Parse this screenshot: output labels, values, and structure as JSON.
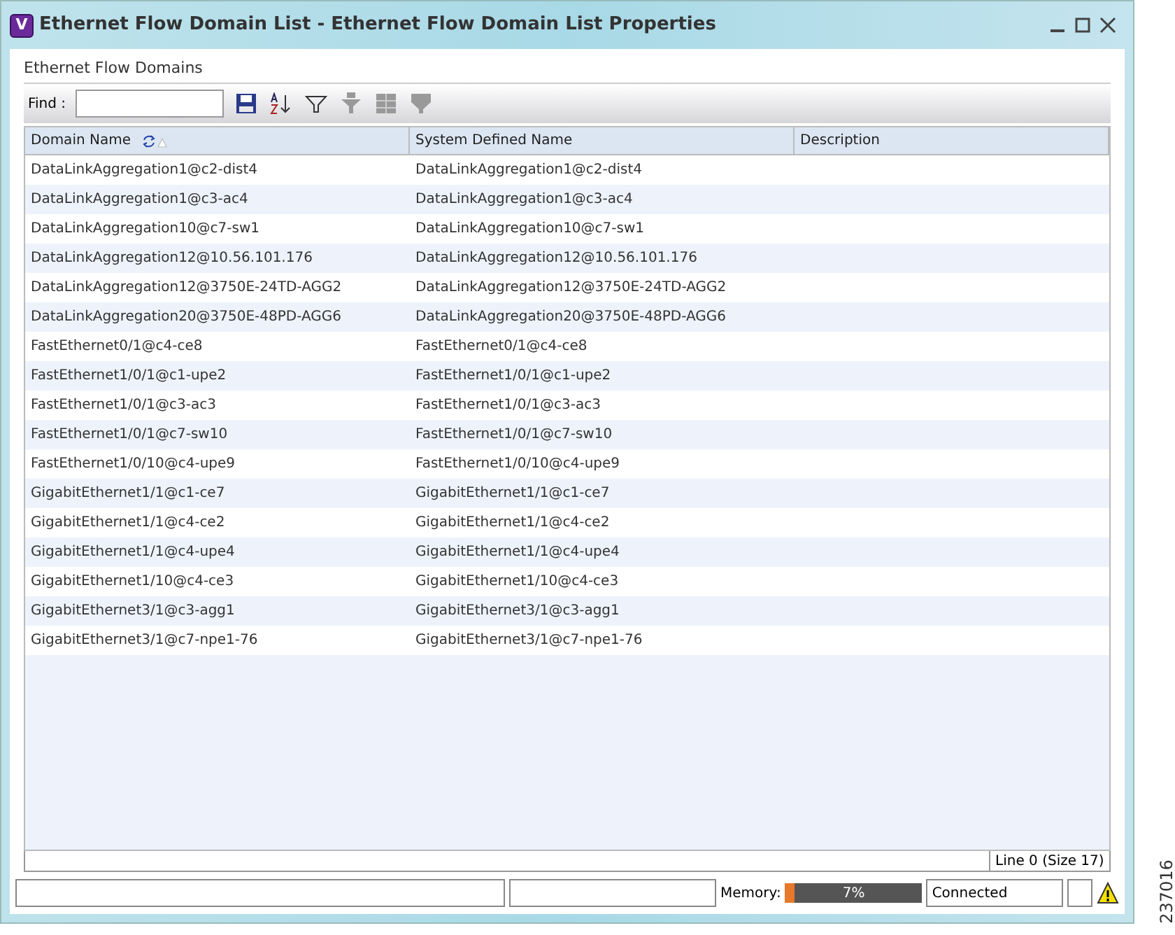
{
  "window": {
    "title": "Ethernet Flow Domain List - Ethernet Flow Domain List Properties",
    "logo": "V"
  },
  "panel_title": "Ethernet Flow Domains",
  "find": {
    "label": "Find :"
  },
  "table": {
    "columns": [
      {
        "label": "Domain Name",
        "sorted": true
      },
      {
        "label": "System Defined Name",
        "sorted": false
      },
      {
        "label": "Description",
        "sorted": false
      }
    ],
    "rows": [
      [
        "DataLinkAggregation1@c2-dist4",
        "DataLinkAggregation1@c2-dist4"
      ],
      [
        "DataLinkAggregation1@c3-ac4",
        "DataLinkAggregation1@c3-ac4"
      ],
      [
        "DataLinkAggregation10@c7-sw1",
        "DataLinkAggregation10@c7-sw1"
      ],
      [
        "DataLinkAggregation12@10.56.101.176",
        "DataLinkAggregation12@10.56.101.176"
      ],
      [
        "DataLinkAggregation12@3750E-24TD-AGG2",
        "DataLinkAggregation12@3750E-24TD-AGG2"
      ],
      [
        "DataLinkAggregation20@3750E-48PD-AGG6",
        "DataLinkAggregation20@3750E-48PD-AGG6"
      ],
      [
        "FastEthernet0/1@c4-ce8",
        "FastEthernet0/1@c4-ce8"
      ],
      [
        "FastEthernet1/0/1@c1-upe2",
        "FastEthernet1/0/1@c1-upe2"
      ],
      [
        "FastEthernet1/0/1@c3-ac3",
        "FastEthernet1/0/1@c3-ac3"
      ],
      [
        "FastEthernet1/0/1@c7-sw10",
        "FastEthernet1/0/1@c7-sw10"
      ],
      [
        "FastEthernet1/0/10@c4-upe9",
        "FastEthernet1/0/10@c4-upe9"
      ],
      [
        "GigabitEthernet1/1@c1-ce7",
        "GigabitEthernet1/1@c1-ce7"
      ],
      [
        "GigabitEthernet1/1@c4-ce2",
        "GigabitEthernet1/1@c4-ce2"
      ],
      [
        "GigabitEthernet1/1@c4-upe4",
        "GigabitEthernet1/1@c4-upe4"
      ],
      [
        "GigabitEthernet1/10@c4-ce3",
        "GigabitEthernet1/10@c4-ce3"
      ],
      [
        "GigabitEthernet3/1@c3-agg1",
        "GigabitEthernet3/1@c3-agg1"
      ],
      [
        "GigabitEthernet3/1@c7-npe1-76",
        "GigabitEthernet3/1@c7-npe1-76"
      ]
    ]
  },
  "table_footer": "Line 0 (Size 17)",
  "status_bar": {
    "memory_label": "Memory:",
    "memory": {
      "level": 0.07,
      "reading": "7%"
    },
    "connection": "Connected",
    "warning": true
  },
  "figure_number": "237016"
}
